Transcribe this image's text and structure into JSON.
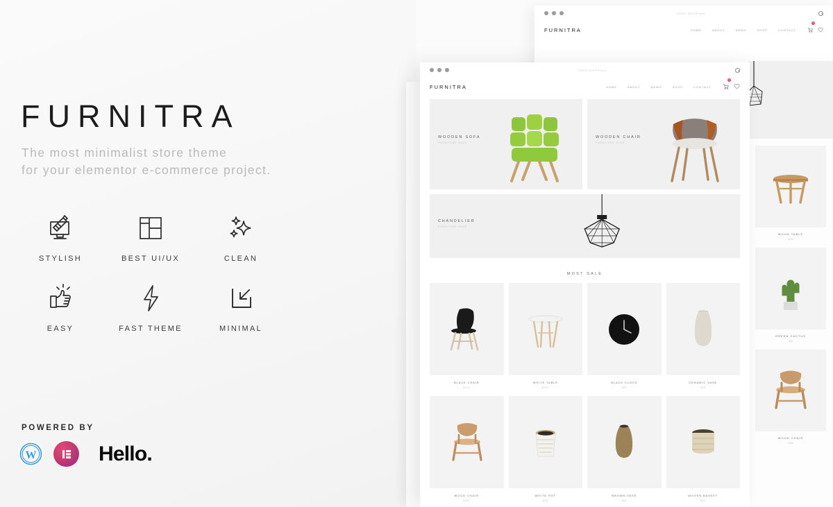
{
  "left": {
    "title": "FURNITRA",
    "tagline_line1": "The most minimalist store theme",
    "tagline_line2": "for your elementor e-commerce project.",
    "features": [
      {
        "icon": "brush-monitor-icon",
        "label": "STYLISH"
      },
      {
        "icon": "grid-layout-icon",
        "label": "BEST UI/UX"
      },
      {
        "icon": "sparkles-icon",
        "label": "CLEAN"
      },
      {
        "icon": "thumbs-up-icon",
        "label": "EASY"
      },
      {
        "icon": "lightning-bolt-icon",
        "label": "FAST THEME"
      },
      {
        "icon": "minimize-arrow-icon",
        "label": "MINIMAL"
      }
    ],
    "powered_by_label": "POWERED BY",
    "powered_by": [
      {
        "icon": "wordpress-icon",
        "name": "WordPress"
      },
      {
        "icon": "elementor-icon",
        "name": "Elementor"
      },
      {
        "icon": "hello-wordmark",
        "name": "Hello."
      }
    ]
  },
  "mockup": {
    "logo": "FURNITRA",
    "topbar_text": "FREE SHIPPING",
    "nav": [
      "HOME",
      "ABOUT",
      "NEWS",
      "SHOP",
      "CONTACT"
    ],
    "cart_count": "2",
    "hero": [
      {
        "title": "WOODEN SOFA",
        "subtitle": "FURNITURE SHOP",
        "image": "green-lounge-chair"
      },
      {
        "title": "WOODEN CHAIR",
        "subtitle": "FURNITURE SHOP",
        "image": "walnut-grey-armchair"
      }
    ],
    "banner": {
      "title": "CHANDELIER",
      "subtitle": "FURNITURE SHOP",
      "image": "geometric-pendant-lamp"
    },
    "section_title": "MOST SALE",
    "products_row1": [
      {
        "name": "BLACK CHAIR",
        "price": "$120",
        "image": "black-eames-chair"
      },
      {
        "name": "WHITE TABLE",
        "price": "$210",
        "image": "white-round-table"
      },
      {
        "name": "BLACK CLOCK",
        "price": "$60",
        "image": "black-wall-clock"
      },
      {
        "name": "CERAMIC VASE",
        "price": "$45",
        "image": "beige-ceramic-vase"
      }
    ],
    "products_row2": [
      {
        "name": "WOOD CHAIR",
        "price": "$180",
        "image": "plywood-lounge-chair"
      },
      {
        "name": "WHITE POT",
        "price": "$35",
        "image": "patterned-white-pot"
      },
      {
        "name": "BROWN VASE",
        "price": "$55",
        "image": "brown-clay-vase"
      },
      {
        "name": "WOVEN BASKET",
        "price": "$40",
        "image": "woven-lidded-basket"
      }
    ]
  },
  "side": {
    "items": [
      {
        "name": "WOOD TABLE",
        "price": "$200",
        "image": "wood-side-table"
      },
      {
        "name": "GREEN CACTUS",
        "price": "$25",
        "image": "green-cactus-pot"
      },
      {
        "name": "WOOD CHAIR",
        "price": "$180",
        "image": "plywood-lounge-chair"
      }
    ]
  },
  "colors": {
    "accent": "#e8416b",
    "background": "#fafafa",
    "text_dark": "#1c1c1c",
    "text_muted": "#b9b9b9"
  }
}
